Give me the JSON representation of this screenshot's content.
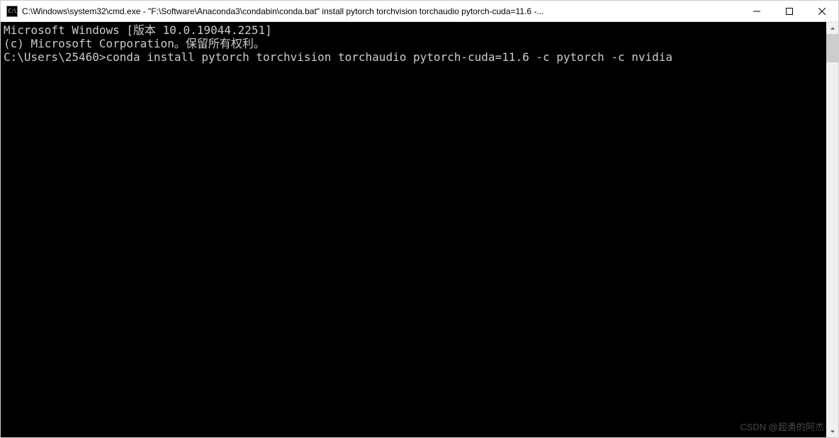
{
  "titlebar": {
    "icon_label": "C:\\",
    "title": "C:\\Windows\\system32\\cmd.exe - \"F:\\Software\\Anaconda3\\condabin\\conda.bat\"  install pytorch torchvision torchaudio pytorch-cuda=11.6 -..."
  },
  "terminal": {
    "lines": [
      "Microsoft Windows [版本 10.0.19044.2251]",
      "(c) Microsoft Corporation。保留所有权利。",
      "",
      "C:\\Users\\25460>conda install pytorch torchvision torchaudio pytorch-cuda=11.6 -c pytorch -c nvidia"
    ]
  },
  "watermark": "CSDN @超勇的阿杰"
}
